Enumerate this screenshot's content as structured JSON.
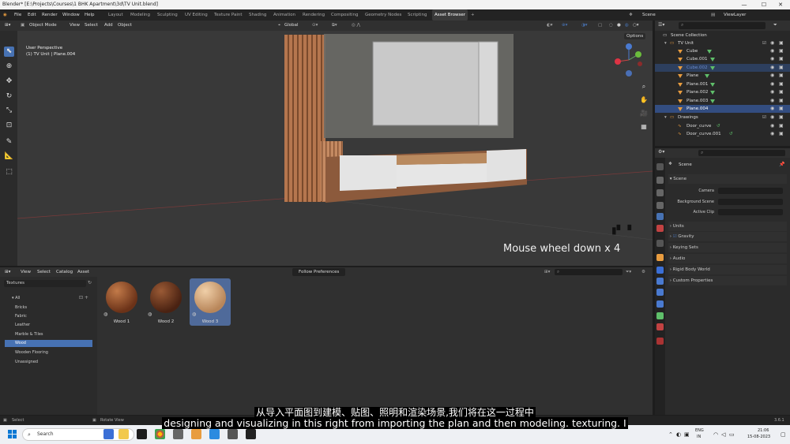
{
  "window": {
    "title": "Blender* [E:\\Projects\\Courses\\1 BHK Apartment\\3d\\TV Unit.blend]"
  },
  "menu": [
    "File",
    "Edit",
    "Render",
    "Window",
    "Help"
  ],
  "workspaces": [
    "Layout",
    "Modeling",
    "Sculpting",
    "UV Editing",
    "Texture Paint",
    "Shading",
    "Animation",
    "Rendering",
    "Compositing",
    "Geometry Nodes",
    "Scripting",
    "Asset Browser"
  ],
  "active_workspace": "Asset Browser",
  "scene_field": "Scene",
  "viewlayer_field": "ViewLayer",
  "viewport": {
    "mode": "Object Mode",
    "menus": [
      "View",
      "Select",
      "Add",
      "Object"
    ],
    "transform": "Global",
    "options": "Options",
    "info_line1": "User Perspective",
    "info_line2": "(1) TV Unit | Plane.004",
    "overlay_text": "Mouse wheel down x 4"
  },
  "asset_browser": {
    "menus": [
      "View",
      "Select",
      "Catalog",
      "Asset"
    ],
    "library": "Textures",
    "import_method": "Follow Preferences",
    "catalogs": [
      "All",
      "Bricks",
      "Fabric",
      "Leather",
      "Marble & Tiles",
      "Wood",
      "Wooden Flooring",
      "Unassigned"
    ],
    "selected_catalog": "Wood",
    "assets": [
      "Wood 1",
      "Wood 2",
      "Wood 3"
    ],
    "selected_asset": "Wood 3"
  },
  "outliner": {
    "rows": [
      "Scene Collection",
      "TV Unit",
      "Cube",
      "Cube.001",
      "Cube.002",
      "Plane",
      "Plane.001",
      "Plane.002",
      "Plane.003",
      "Plane.004",
      "Drawings",
      "Door_curve",
      "Door_curve.001"
    ],
    "selected": "Plane.004"
  },
  "properties": {
    "title": "Scene",
    "panel": "Scene",
    "camera_label": "Camera",
    "background_label": "Background Scene",
    "clip_label": "Active Clip",
    "sections": [
      "Units",
      "Gravity",
      "Keying Sets",
      "Audio",
      "Rigid Body World",
      "Custom Properties"
    ]
  },
  "status": {
    "left": "Select",
    "middle": "Rotate View",
    "version": "3.6.1"
  },
  "taskbar": {
    "search": "Search",
    "lang1": "ENG",
    "lang2": "IN",
    "time": "21:06",
    "date": "15-08-2023"
  },
  "subtitles": {
    "line1": "从导入平面图到建模、贴图、照明和渲染场景,我们将在这一过程中",
    "line2": "designing and visualizing in this right from importing the plan and then modeling. texturing. I"
  }
}
